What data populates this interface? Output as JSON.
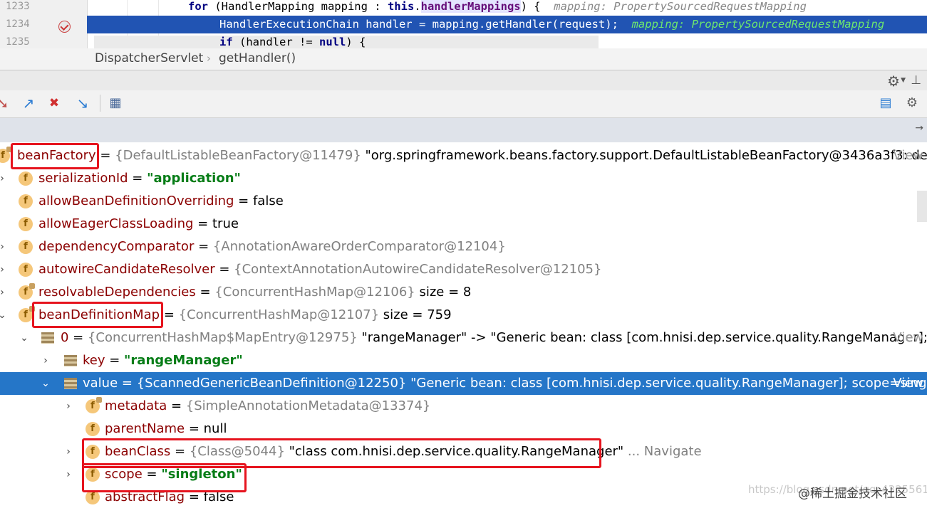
{
  "editor": {
    "lines": [
      {
        "number": "1233",
        "kw": "for",
        "text": " (HandlerMapping mapping : ",
        "kw2": "this",
        "dot": ".",
        "field": "handlerMappings",
        "after": ") {",
        "hint": "mapping: PropertySourcedRequestMapping"
      },
      {
        "number": "1234",
        "text": "HandlerExecutionChain handler = mapping.getHandler(request);",
        "hint": "mapping: PropertySourcedRequestMapping"
      },
      {
        "number": "1235",
        "kw": "if",
        "text": " (handler != ",
        "kw2": "null",
        "after": ") {"
      }
    ]
  },
  "breadcrumb": {
    "class_name": "DispatcherServlet",
    "separator": "›",
    "method": "getHandler()"
  },
  "toolbar": {
    "icons": [
      "step-out-icon",
      "jump-to-source-icon",
      "close-frame-icon",
      "run-to-cursor-icon",
      "evaluate-expression-icon"
    ],
    "right_icons": [
      "restore-layout-icon",
      "settings-icon"
    ]
  },
  "tree": [
    {
      "name": "beanFactory",
      "eq": " = ",
      "ref": "{DefaultListableBeanFactory@11479}",
      "value": " \"org.springframework.beans.factory.support.DefaultListableBeanFactory@3436a3f3: de",
      "view": "View"
    },
    {
      "name": "serializationId",
      "eq": " = ",
      "str": "\"application\""
    },
    {
      "name": "allowBeanDefinitionOverriding",
      "eq": " = ",
      "value": "false"
    },
    {
      "name": "allowEagerClassLoading",
      "eq": " = ",
      "value": "true"
    },
    {
      "name": "dependencyComparator",
      "eq": " = ",
      "ref": "{AnnotationAwareOrderComparator@12104}"
    },
    {
      "name": "autowireCandidateResolver",
      "eq": " = ",
      "ref": "{ContextAnnotationAutowireCandidateResolver@12105}"
    },
    {
      "name": "resolvableDependencies",
      "eq": " = ",
      "ref": "{ConcurrentHashMap@12106}",
      "value": "  size = 8"
    },
    {
      "name": "beanDefinitionMap",
      "eq": " = ",
      "ref": "{ConcurrentHashMap@12107}",
      "value": "  size = 759"
    },
    {
      "name": "0",
      "eq": " = ",
      "ref": "{ConcurrentHashMap$MapEntry@12975}",
      "value": " \"rangeManager\" -> \"Generic bean: class [com.hnisi.dep.service.quality.RangeManager];",
      "view": "View"
    },
    {
      "name": "key",
      "eq": " = ",
      "str": "\"rangeManager\""
    },
    {
      "name": "value",
      "eq": " = ",
      "ref": "{ScannedGenericBeanDefinition@12250}",
      "value": " \"Generic bean: class [com.hnisi.dep.service.quality.RangeManager]; scope=single",
      "view": "View"
    },
    {
      "name": "metadata",
      "eq": " = ",
      "ref": "{SimpleAnnotationMetadata@13374}"
    },
    {
      "name": "parentName",
      "eq": " = ",
      "value": "null"
    },
    {
      "name": "beanClass",
      "eq": " = ",
      "ref": "{Class@5044}",
      "value": " \"class com.hnisi.dep.service.quality.RangeManager\"",
      "nav": " ... Navigate"
    },
    {
      "name": "scope",
      "eq": " = ",
      "str": "\"singleton\""
    },
    {
      "name": "abstractFlag",
      "eq": " = ",
      "value": "false"
    }
  ],
  "watermark": "https://blog.csdn.net/qq_43255617",
  "logo": "@稀土掘金技术社区",
  "colors": {
    "selection": "#2576c8",
    "current_line": "#2154b3",
    "highlight_box": "#e6141e",
    "string": "#067d17",
    "field_name": "#8b0000"
  }
}
